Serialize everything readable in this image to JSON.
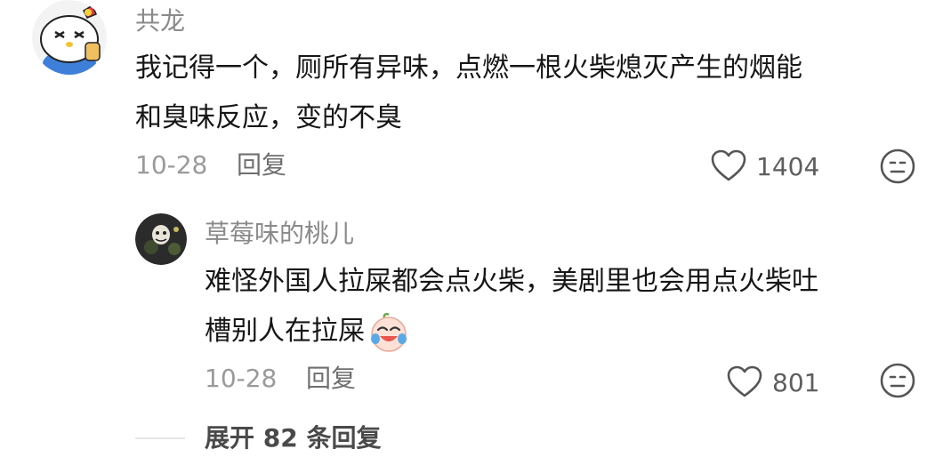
{
  "comment": {
    "username": "共龙",
    "text_line1": "我记得一个，厕所有异味，点燃一根火柴熄灭产生的烟能",
    "text_line2": "和臭味反应，变的不臭",
    "date": "10-28",
    "reply_label": "回复",
    "like_count": "1404",
    "avatar_icon": "hello-kitty-avatar",
    "like_icon": "heart-outline-icon",
    "dislike_icon": "unamused-face-icon"
  },
  "reply": {
    "username": "草莓味的桃儿",
    "text_line1": "难怪外国人拉屎都会点火柴，美剧里也会用点火柴吐",
    "text_line2": "槽别人在拉屎",
    "emoji": "laughing-crying-face-emoji",
    "date": "10-28",
    "reply_label": "回复",
    "like_count": "801",
    "avatar_icon": "dark-photo-avatar",
    "like_icon": "heart-outline-icon",
    "dislike_icon": "unamused-face-icon"
  },
  "expand": {
    "label": "展开 82 条回复"
  },
  "colors": {
    "username": "#8a8a8a",
    "text": "#161616",
    "meta": "#9a9a9a",
    "icon": "#555555"
  }
}
